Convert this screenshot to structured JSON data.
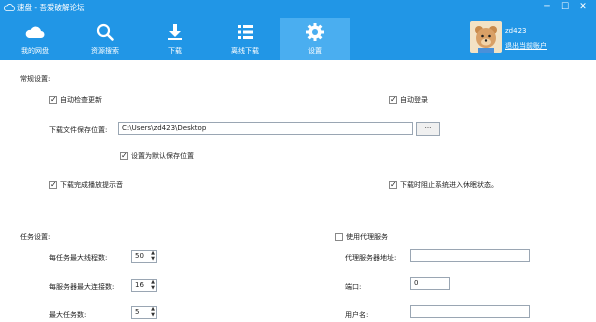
{
  "window": {
    "title": "速盘 - 吾爱破解论坛",
    "minimize": "─",
    "maximize": "☐",
    "close": "✕"
  },
  "nav": [
    {
      "label": "我的网盘",
      "icon": "cloud-icon"
    },
    {
      "label": "资源搜索",
      "icon": "search-icon"
    },
    {
      "label": "下载",
      "icon": "download-icon"
    },
    {
      "label": "离线下载",
      "icon": "list-icon"
    },
    {
      "label": "设置",
      "icon": "gear-icon",
      "active": true
    }
  ],
  "user": {
    "name": "zd423",
    "logout": "退出当前账户"
  },
  "general": {
    "title": "常规设置:",
    "auto_update": "自动检查更新",
    "auto_login": "自动登录",
    "save_path_label": "下载文件保存位置:",
    "save_path_value": "C:\\Users\\zd423\\Desktop",
    "browse": "···",
    "set_default_path": "设置为默认保存位置",
    "play_sound": "下载完成播放提示音",
    "prevent_sleep": "下载时阻止系统进入休眠状态。"
  },
  "task": {
    "title": "任务设置:",
    "max_threads_label": "每任务最大线程数:",
    "max_threads": "50",
    "max_connections_label": "每服务器最大连接数:",
    "max_connections": "16",
    "max_tasks_label": "最大任务数:",
    "max_tasks": "5"
  },
  "proxy": {
    "use_proxy": "使用代理服务",
    "server_label": "代理服务器地址:",
    "server_value": "",
    "port_label": "端口:",
    "port_value": "0",
    "user_label": "用户名:",
    "user_value": ""
  },
  "colors": {
    "header": "#2196e6",
    "active_tab": "#4aaef0"
  }
}
